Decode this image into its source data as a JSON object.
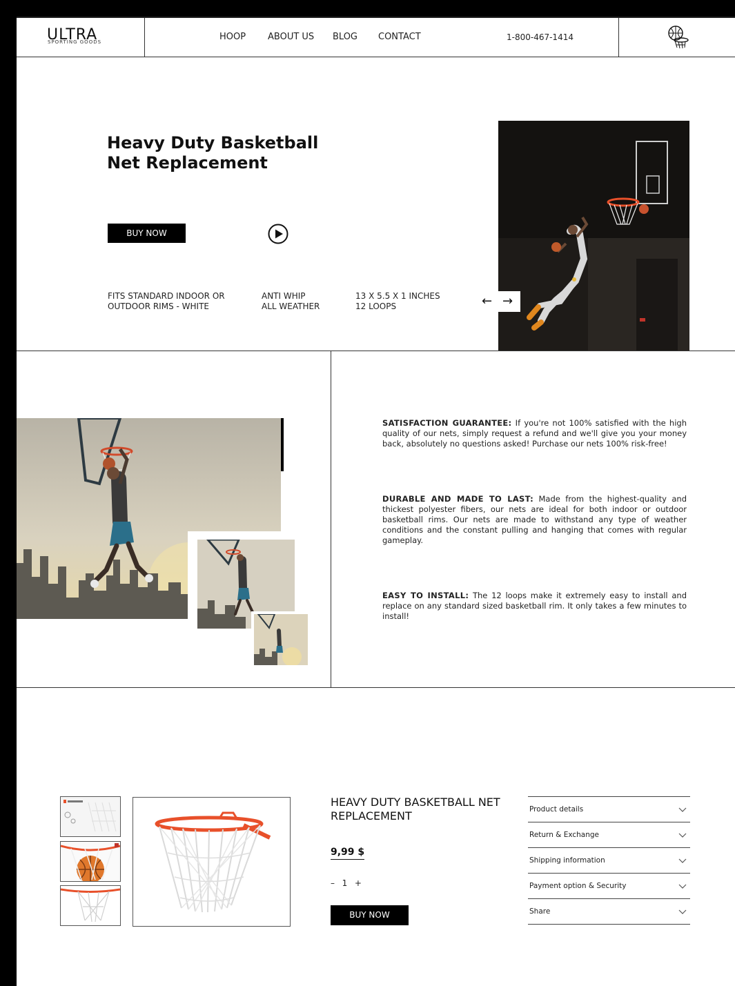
{
  "header": {
    "logo": {
      "name": "ULTRA",
      "tagline": "SPORTING GOODS"
    },
    "nav": [
      "HOOP",
      "ABOUT US",
      "BLOG",
      "CONTACT"
    ],
    "phone": "1-800-467-1414",
    "icon": "basketball-hoop-icon"
  },
  "hero": {
    "title": "Heavy Duty Basketball Net Replacement",
    "buy_label": "BUY NOW",
    "play_icon": "play-icon",
    "features": [
      "FITS STANDARD INDOOR OR\nOUTDOOR RIMS - WHITE",
      "ANTI WHIP\nALL WEATHER",
      "13 X 5.5 X 1 INCHES\n12 LOOPS"
    ],
    "arrow_prev": "←",
    "arrow_next": "→"
  },
  "benefits": [
    {
      "heading": "SATISFACTION GUARANTEE:",
      "text": " If you're not 100% satisfied with the high quality of our nets, simply request a refund and we'll give you your money back, absolutely no questions asked! Purchase our nets 100% risk-free!"
    },
    {
      "heading": "DURABLE AND MADE TO LAST:",
      "text": " Made from the highest-quality and thickest polyester fibers, our nets are ideal for both indoor or outdoor basketball rims. Our nets are made to withstand any type of weather conditions and the constant pulling and hanging that comes with regular gameplay."
    },
    {
      "heading": "EASY TO INSTALL:",
      "text": " The 12 loops make it extremely easy to install and replace on any standard sized basketball rim. It only takes a few minutes to install!"
    }
  ],
  "product": {
    "title": "HEAVY DUTY BASKETBALL NET REPLACEMENT",
    "price": "9,99 $",
    "qty_minus": "–",
    "qty_value": "1",
    "qty_plus": "+",
    "buy_label": "BUY NOW",
    "accordion": [
      "Product details",
      "Return & Exchange",
      "Shipping information",
      "Payment option & Security",
      "Share"
    ]
  },
  "colors": {
    "accent_black": "#000000",
    "rim_orange": "#e8502a",
    "background": "#ffffff"
  }
}
